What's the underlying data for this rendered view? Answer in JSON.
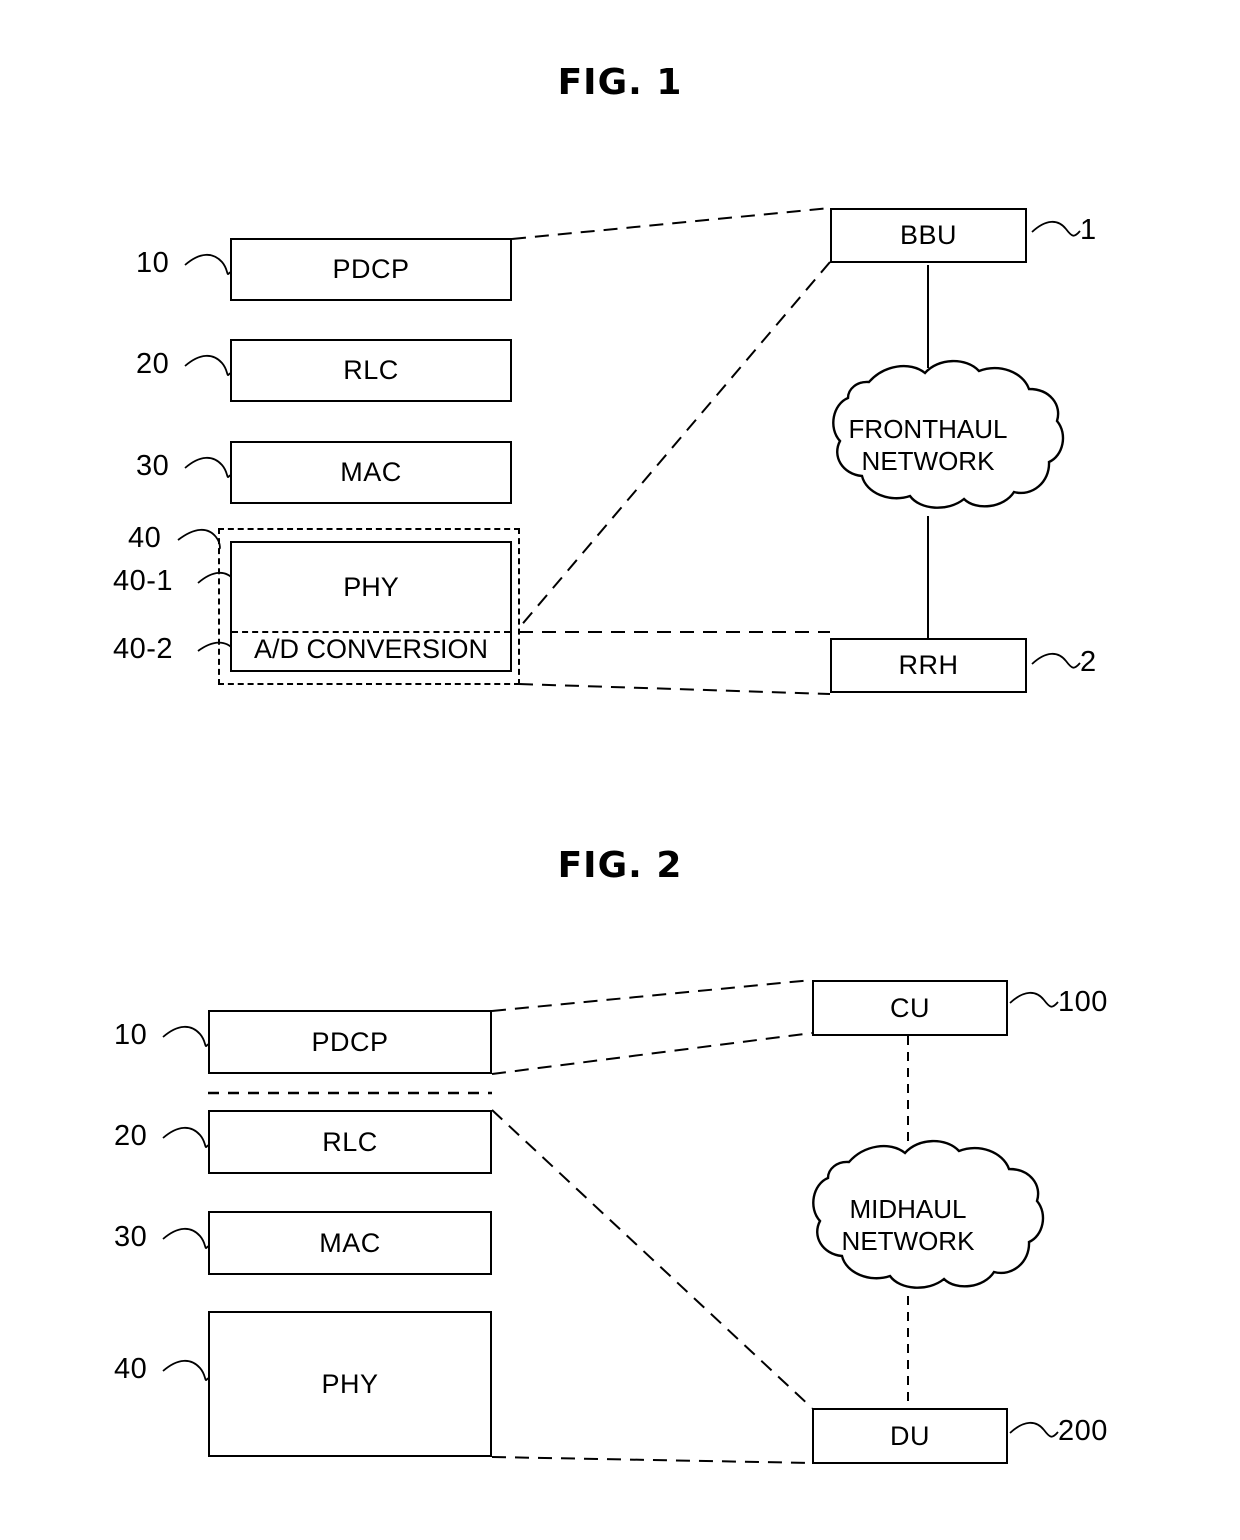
{
  "document": {
    "kind": "patent-drawing-sheet",
    "figures": [
      {
        "id": "fig1",
        "title": "FIG. 1",
        "stack": {
          "layers": [
            {
              "ref": "10",
              "label": "PDCP"
            },
            {
              "ref": "20",
              "label": "RLC"
            },
            {
              "ref": "30",
              "label": "MAC"
            }
          ],
          "phy_group": {
            "ref_group": "40",
            "ref_phy": "40-1",
            "ref_adc": "40-2",
            "phy_label": "PHY",
            "adc_label": "A/D CONVERSION"
          }
        },
        "network": {
          "top_node": {
            "label": "BBU",
            "ref": "1"
          },
          "cloud": {
            "label": "FRONTHAUL\nNETWORK"
          },
          "bottom_node": {
            "label": "RRH",
            "ref": "2"
          }
        }
      },
      {
        "id": "fig2",
        "title": "FIG. 2",
        "stack": {
          "layers": [
            {
              "ref": "10",
              "label": "PDCP"
            },
            {
              "ref": "20",
              "label": "RLC"
            },
            {
              "ref": "30",
              "label": "MAC"
            },
            {
              "ref": "40",
              "label": "PHY"
            }
          ]
        },
        "network": {
          "top_node": {
            "label": "CU",
            "ref": "100"
          },
          "cloud": {
            "label": "MIDHAUL\nNETWORK"
          },
          "bottom_node": {
            "label": "DU",
            "ref": "200"
          }
        }
      }
    ]
  },
  "colors": {
    "ink": "#000000",
    "paper": "#ffffff"
  }
}
